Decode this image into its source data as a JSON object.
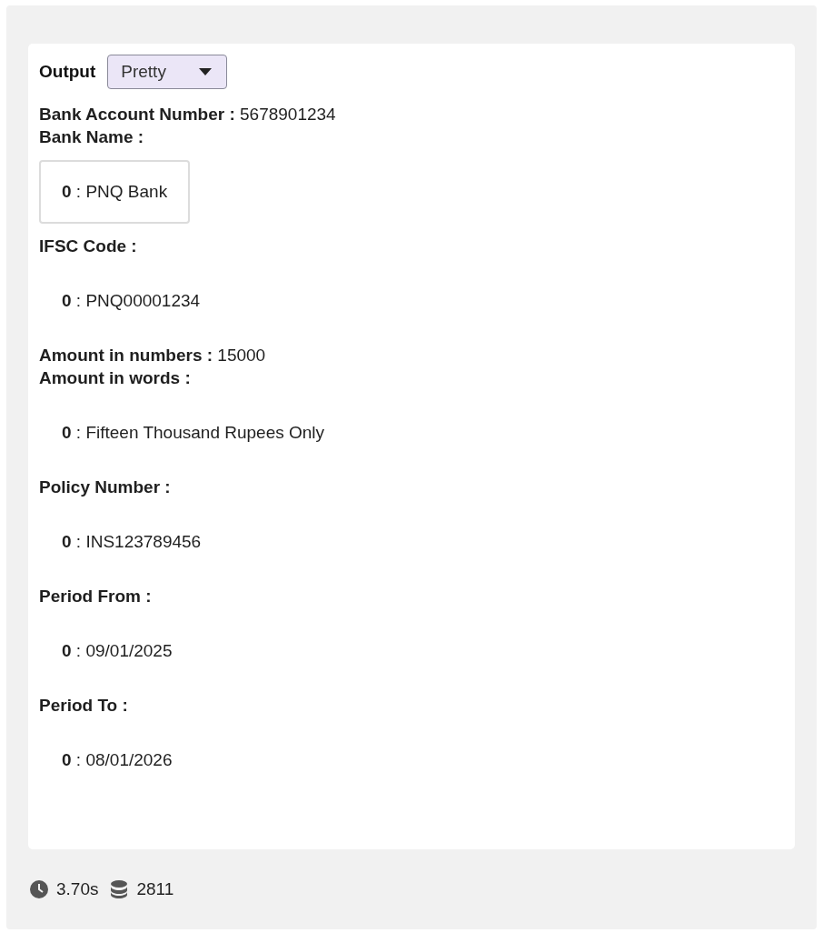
{
  "output": {
    "label": "Output",
    "value": "Pretty"
  },
  "fields": [
    {
      "kind": "inline",
      "text": "**Bank Account Number :** 5678901234"
    },
    {
      "kind": "list",
      "label": "Bank Name :",
      "items": [
        {
          "text": "**0** : PNQ Bank",
          "selected": true
        }
      ]
    },
    {
      "kind": "list",
      "label": "IFSC Code :",
      "items": [
        {
          "text": "**0** : PNQ00001234",
          "selected": false
        }
      ]
    },
    {
      "kind": "inline",
      "text": "**Amount in numbers :** 15000"
    },
    {
      "kind": "list",
      "label": "Amount in words :",
      "items": [
        {
          "text": "**0** : Fifteen Thousand Rupees Only",
          "selected": false
        }
      ]
    },
    {
      "kind": "list",
      "label": "Policy Number :",
      "items": [
        {
          "text": "**0** : INS123789456",
          "selected": false
        }
      ]
    },
    {
      "kind": "list",
      "label": "Period From :",
      "items": [
        {
          "text": "**0** : 09/01/2025",
          "selected": false
        }
      ]
    },
    {
      "kind": "list",
      "label": "Period To :",
      "items": [
        {
          "text": "**0** : 08/01/2026",
          "selected": false
        }
      ]
    }
  ],
  "footer": {
    "time": "3.70s",
    "count": "2811"
  }
}
